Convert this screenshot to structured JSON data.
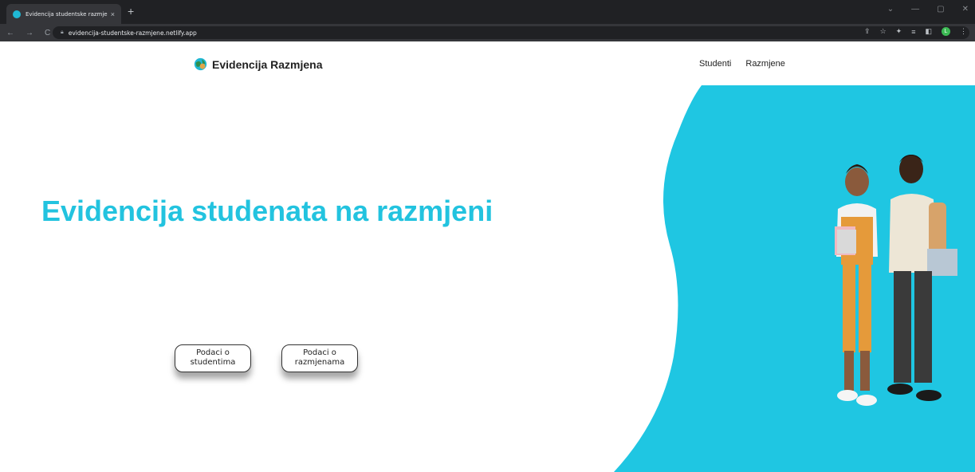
{
  "browser": {
    "tab_title": "Evidencija studentske razmjene",
    "tab_close": "×",
    "new_tab": "+",
    "url": "evidencija-studentske-razmjene.netlify.app",
    "profile_initial": "L"
  },
  "brand": {
    "name": "Evidencija Razmjena"
  },
  "nav": {
    "students": "Studenti",
    "exchanges": "Razmjene"
  },
  "hero": {
    "title": "Evidencija studenata na razmjeni"
  },
  "buttons": {
    "students": {
      "line1": "Podaci o",
      "line2": "studentima"
    },
    "exchanges": {
      "line1": "Podaci o",
      "line2": "razmjenama"
    }
  },
  "colors": {
    "accent": "#22c3df",
    "blob": "#1fc6e2",
    "chrome_dark": "#202124"
  }
}
